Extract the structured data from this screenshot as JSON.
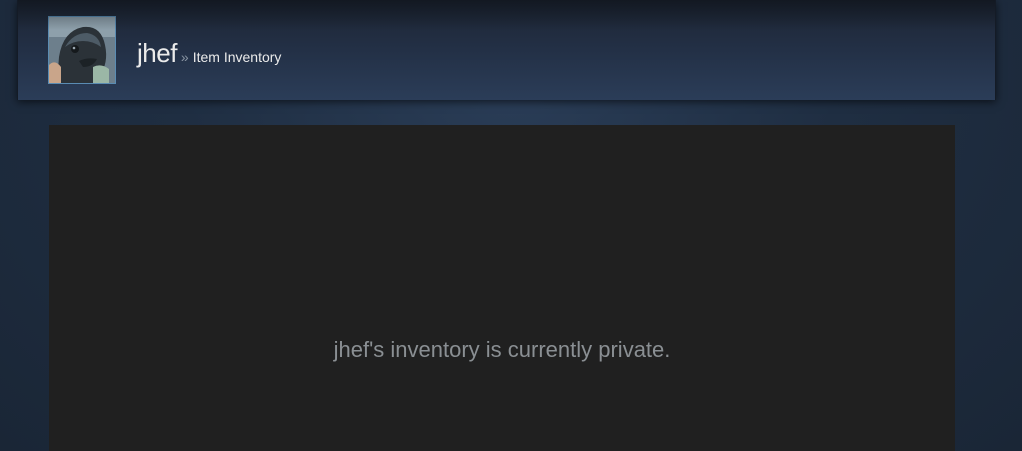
{
  "profile": {
    "username": "jhef",
    "separator": "»",
    "section_label": "Item Inventory",
    "avatar_icon": "avatar-photo"
  },
  "inventory": {
    "message": "jhef's inventory is currently private."
  },
  "colors": {
    "page_bg": "#1b2838",
    "header_bg": "#233046",
    "panel_bg": "#202020",
    "avatar_border": "#5a8cb3",
    "text_primary": "#ebebeb",
    "text_muted": "#8a8f93"
  }
}
